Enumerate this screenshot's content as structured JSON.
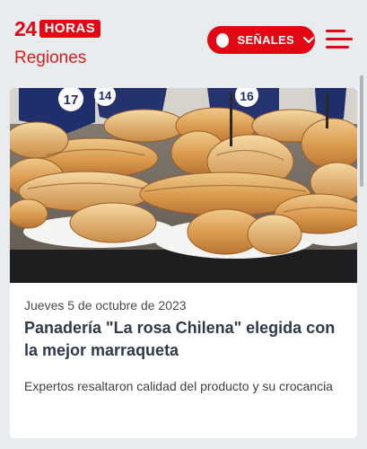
{
  "header": {
    "logo_number": "24",
    "logo_word": "HORAS",
    "section": "Regiones",
    "signals_label": "SEÑALES",
    "menu_icon": "hamburger-menu-icon",
    "brand_color": "#e30613"
  },
  "article": {
    "date": "Jueves 5 de octubre de 2023",
    "title": "Panadería \"La rosa Chilena\" elegida con la mejor marraqueta",
    "summary": "Expertos resaltaron calidad del producto y su crocancia",
    "photo_tags": [
      "17",
      "14",
      "16"
    ]
  }
}
